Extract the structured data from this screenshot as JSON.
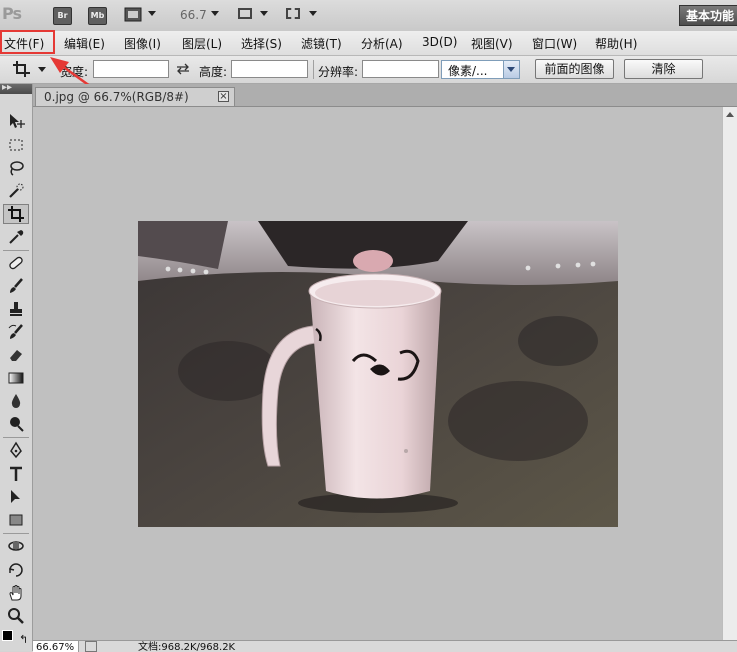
{
  "app": {
    "logo": "Ps",
    "bridge": "Br",
    "minibridge": "Mb",
    "zoom": "66.7",
    "workspace": "基本功能"
  },
  "menu": [
    {
      "label": "文件(F)"
    },
    {
      "label": "编辑(E)"
    },
    {
      "label": "图像(I)"
    },
    {
      "label": "图层(L)"
    },
    {
      "label": "选择(S)"
    },
    {
      "label": "滤镜(T)"
    },
    {
      "label": "分析(A)"
    },
    {
      "label": "3D(D)"
    },
    {
      "label": "视图(V)"
    },
    {
      "label": "窗口(W)"
    },
    {
      "label": "帮助(H)"
    }
  ],
  "options": {
    "width_label": "宽度:",
    "height_label": "高度:",
    "resolution_label": "分辨率:",
    "unit_value": "像素/...",
    "front_image_button": "前面的图像",
    "clear_button": "清除"
  },
  "document": {
    "tab_title": "0.jpg @ 66.7%(RGB/8#)",
    "close_glyph": "×"
  },
  "status": {
    "zoom": "66.67%",
    "doc_info": "文档:968.2K/968.2K"
  },
  "colors": {
    "annotation_red": "#e53935"
  }
}
